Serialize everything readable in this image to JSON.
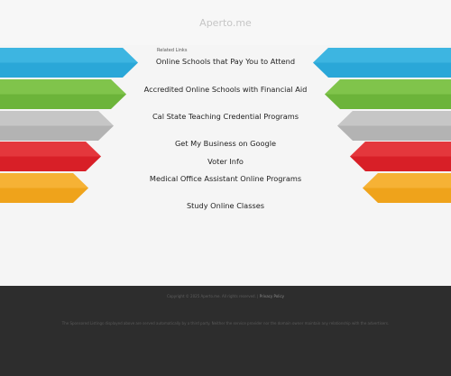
{
  "header": {
    "site_title": "Aperto.me"
  },
  "related": {
    "heading": "Related Links",
    "links": [
      "Online Schools that Pay You to Attend",
      "Accredited Online Schools with Financial Aid",
      "Cal State Teaching Credential Programs",
      "Get My Business on Google",
      "Voter Info",
      "Medical Office Assistant Online Programs",
      "Study Online Classes"
    ]
  },
  "colors": {
    "blue": "#2aa7d8",
    "green": "#7ac142",
    "gray": "#b9b9b9",
    "red": "#e2242c",
    "orange": "#f4a81d",
    "footer": "#2d2d2d"
  },
  "footer": {
    "copyright": "Copyright © 2025 Aperto.me. All rights reserved.",
    "privacy": "Privacy Policy",
    "disclaimer": "The Sponsored Listings displayed above are served automatically by a third party. Neither the service provider nor the domain owner maintain any relationship with the advertisers."
  }
}
